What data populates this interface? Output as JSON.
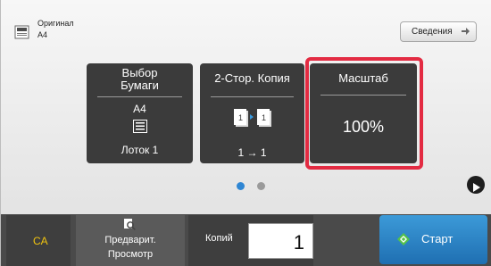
{
  "original": {
    "label": "Оригинал",
    "size": "A4"
  },
  "details_button": {
    "label": "Сведения"
  },
  "tiles": {
    "paper": {
      "title_line1": "Выбор",
      "title_line2": "Бумаги",
      "size": "A4",
      "tray": "Лоток 1"
    },
    "duplex": {
      "title": "2-Стор. Копия",
      "mode": "1 → 1"
    },
    "scale": {
      "title": "Масштаб",
      "value": "100%"
    }
  },
  "pager": {
    "pages": 2,
    "current": 1
  },
  "bottom": {
    "ca_label": "CA",
    "preview_line1": "Предварит.",
    "preview_line2": "Просмотр",
    "copies_label": "Копий",
    "copies_value": "1",
    "start_label": "Старт"
  },
  "colors": {
    "highlight": "#e32b42",
    "tile": "#3b3b3b",
    "start": "#1f6fb2",
    "ca": "#f1c40f",
    "dot_active": "#2f86d3"
  }
}
